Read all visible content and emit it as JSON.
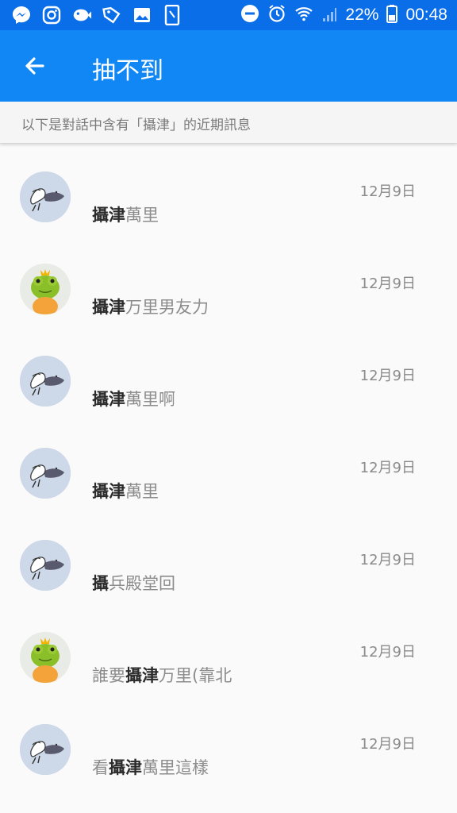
{
  "status_bar": {
    "icons": [
      "messenger-icon",
      "instagram-icon",
      "fish-app-icon",
      "tag-icon",
      "image-icon",
      "phone-icon"
    ],
    "battery_percent": "22%",
    "time": "00:48"
  },
  "app_bar": {
    "title": "抽不到",
    "colors": {
      "status": "#0a6ee8",
      "bar": "#1187f5"
    }
  },
  "banner_text": "以下是對話中含有「攝津」的近期訊息",
  "messages": [
    {
      "avatar": "sketch",
      "date": "12月9日",
      "pre": "",
      "highlight": "攝津",
      "post": "萬里"
    },
    {
      "avatar": "frog",
      "date": "12月9日",
      "pre": "",
      "highlight": "攝津",
      "post": "万里男友力"
    },
    {
      "avatar": "sketch",
      "date": "12月9日",
      "pre": "",
      "highlight": "攝津",
      "post": "萬里啊"
    },
    {
      "avatar": "sketch",
      "date": "12月9日",
      "pre": "",
      "highlight": "攝津",
      "post": "萬里"
    },
    {
      "avatar": "sketch",
      "date": "12月9日",
      "pre": "",
      "highlight": "攝",
      "post": "兵殿堂回"
    },
    {
      "avatar": "frog",
      "date": "12月9日",
      "pre": "誰要",
      "highlight": "攝津",
      "post": "万里(靠北"
    },
    {
      "avatar": "sketch",
      "date": "12月9日",
      "pre": "看",
      "highlight": "攝津",
      "post": "萬里這樣"
    }
  ]
}
